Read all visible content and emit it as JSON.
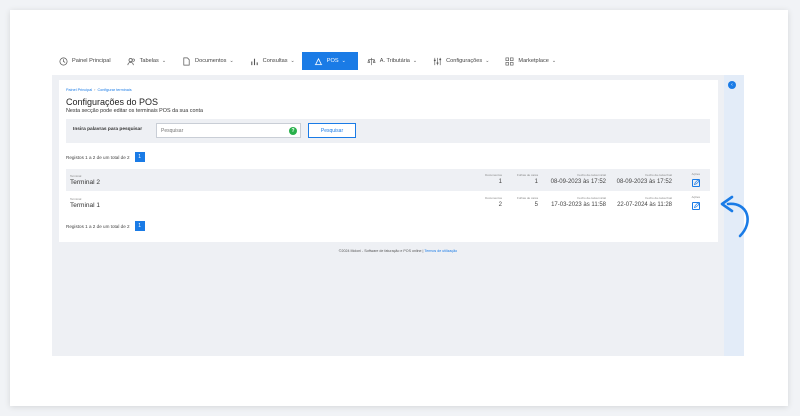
{
  "nav": {
    "items": [
      {
        "label": "Painel Principal",
        "icon": "clock-icon"
      },
      {
        "label": "Tabelas",
        "icon": "people-icon"
      },
      {
        "label": "Documentos",
        "icon": "document-icon"
      },
      {
        "label": "Consultas",
        "icon": "bar-chart-icon"
      },
      {
        "label": "POS",
        "icon": "pos-icon"
      },
      {
        "label": "A. Tributária",
        "icon": "scale-icon"
      },
      {
        "label": "Configurações",
        "icon": "sliders-icon"
      },
      {
        "label": "Marketplace",
        "icon": "grid-icon"
      }
    ],
    "active_color": "#1a7be6"
  },
  "breadcrumb": {
    "home": "Painel Principal",
    "current": "Configurar terminais"
  },
  "page": {
    "title": "Configurações do POS",
    "subtitle": "Nesta secção pode editar os terminais POS da sua conta"
  },
  "search": {
    "label": "Insira palavras para pesquisar",
    "placeholder": "Pesquisar",
    "help": "?",
    "button": "Pesquisar"
  },
  "pager": {
    "summary": "Registos 1 a 2 de um total de 2",
    "page": "1"
  },
  "columns": {
    "terminal": "Terminal",
    "documents": "Documentos",
    "cash_sheets": "Folhas de caixa",
    "open_date": "Fecho da caixa inicial",
    "close_date": "Fecho da caixa final",
    "actions": "Ações"
  },
  "rows": [
    {
      "name": "Terminal 2",
      "documents": "1",
      "cash_sheets": "1",
      "open_date": "08-09-2023 às 17:52",
      "close_date": "08-09-2023 às 17:52"
    },
    {
      "name": "Terminal 1",
      "documents": "2",
      "cash_sheets": "5",
      "open_date": "17-03-2023 às 11:58",
      "close_date": "22-07-2024 às 11:28"
    }
  ],
  "footer": {
    "text": "©2024 Moloni - Software de faturação e POS online | ",
    "link": "Termos de utilização"
  }
}
